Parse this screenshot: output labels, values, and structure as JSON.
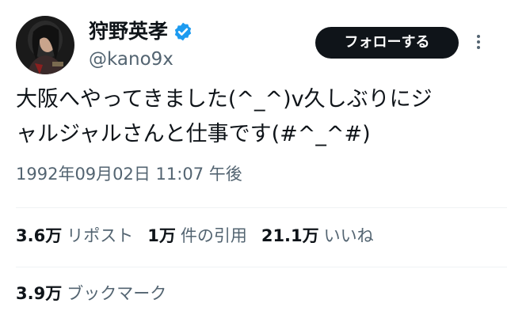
{
  "author": {
    "display_name": "狩野英孝",
    "handle": "@kano9x",
    "avatar_icon": "profile-photo",
    "verified_icon": "verified-badge-icon",
    "verified_color": "#1d9bf0"
  },
  "follow_button": {
    "label": "フォローする"
  },
  "more_icon": "more-vertical-icon",
  "tweet": {
    "text": "大阪へやってきました(^_^)v久しぶりにジ\nャルジャルさんと仕事です(#^_^#)",
    "timestamp": "1992年09月02日 11:07 午後"
  },
  "stats": {
    "reposts": {
      "value": "3.6万",
      "label": "リポスト"
    },
    "quotes": {
      "value": "1万",
      "label": "件の引用"
    },
    "likes": {
      "value": "21.1万",
      "label": "いいね"
    },
    "bookmarks": {
      "value": "3.9万",
      "label": "ブックマーク"
    }
  },
  "colors": {
    "text_primary": "#0f1419",
    "text_secondary": "#536471",
    "divider": "#eff3f4",
    "button_bg": "#0f1419"
  }
}
